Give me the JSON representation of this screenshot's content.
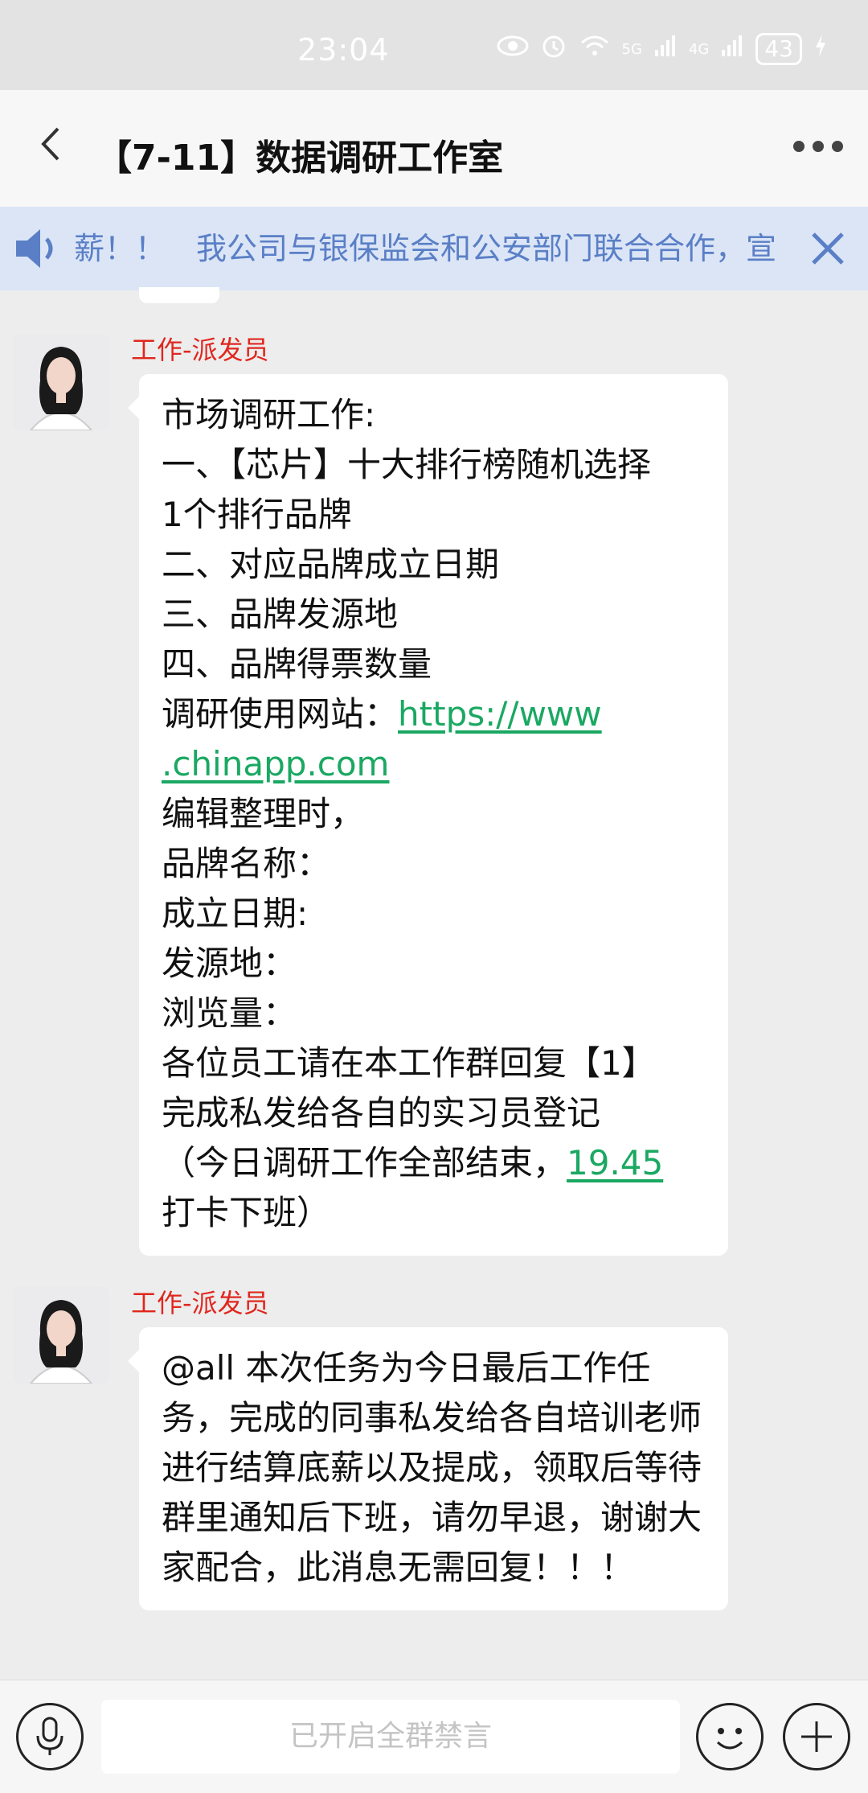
{
  "status_bar": {
    "time": "23:04",
    "signal_5g": "5G",
    "signal_4g": "4G",
    "battery": "43"
  },
  "nav": {
    "title": "【7-11】数据调研工作室"
  },
  "notice": {
    "text": "薪！！　我公司与银保监会和公安部门联合合作，宣"
  },
  "messages": [
    {
      "sender": "工作-派发员",
      "lines": [
        "市场调研工作:",
        "一、【芯片】十大排行榜随机选择",
        "1个排行品牌",
        "二、对应品牌成立日期",
        "三、品牌发源地",
        "四、品牌得票数量"
      ],
      "site_label": "调研使用网站：",
      "site_link_1": "https://www",
      "site_link_2": ".chinapp.com",
      "lines_after": [
        "编辑整理时，",
        "品牌名称：",
        "成立日期:",
        "发源地：",
        "浏览量：",
        "各位员工请在本工作群回复【1】",
        "完成私发给各自的实习员登记"
      ],
      "closing_prefix": "（今日调研工作全部结束，",
      "closing_time": "19.45",
      "closing_suffix": "打卡下班）"
    },
    {
      "sender": "工作-派发员",
      "text": "@all 本次任务为今日最后工作任务，完成的同事私发给各自培训老师进行结算底薪以及提成，领取后等待群里通知后下班，请勿早退，谢谢大家配合，此消息无需回复！！！"
    }
  ],
  "input_bar": {
    "placeholder": "已开启全群禁言"
  }
}
